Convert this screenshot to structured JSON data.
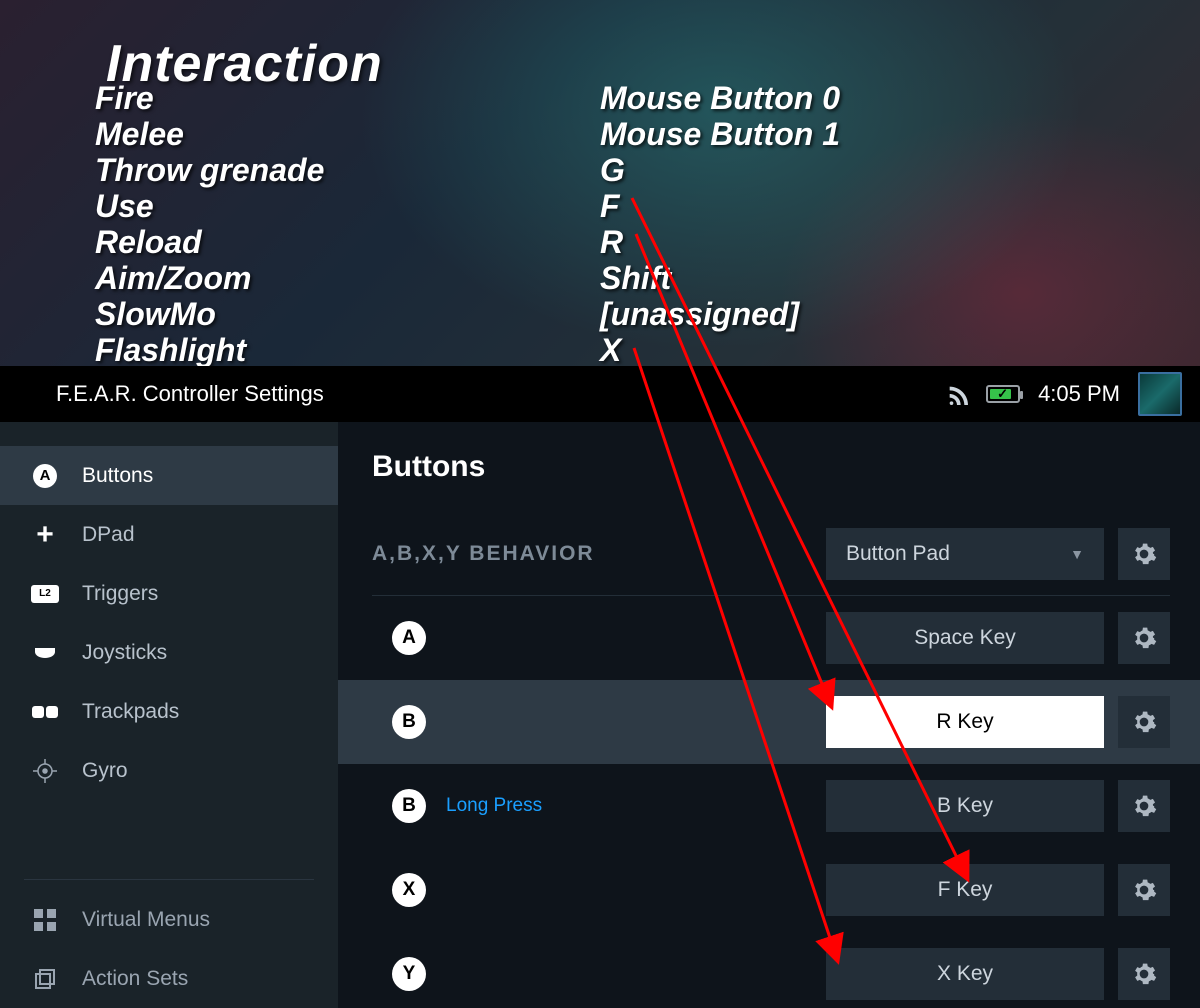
{
  "game": {
    "section_title": "Interaction",
    "bindings": [
      {
        "label": "Fire",
        "value": "Mouse Button 0"
      },
      {
        "label": "Melee",
        "value": "Mouse Button 1"
      },
      {
        "label": "Throw grenade",
        "value": "G"
      },
      {
        "label": "Use",
        "value": "F"
      },
      {
        "label": "Reload",
        "value": "R"
      },
      {
        "label": "Aim/Zoom",
        "value": "Shift"
      },
      {
        "label": "SlowMo",
        "value": "[unassigned]"
      },
      {
        "label": "Flashlight",
        "value": "X"
      }
    ]
  },
  "header": {
    "title": "F.E.A.R. Controller Settings",
    "clock": "4:05 PM"
  },
  "sidebar": {
    "items": [
      {
        "icon": "A",
        "label": "Buttons",
        "active": true
      },
      {
        "icon": "+",
        "label": "DPad"
      },
      {
        "icon": "L2",
        "label": "Triggers"
      },
      {
        "icon": "⌒",
        "label": "Joysticks"
      },
      {
        "icon": "◧",
        "label": "Trackpads"
      },
      {
        "icon": "⊕",
        "label": "Gyro"
      }
    ],
    "lower": [
      {
        "icon": "▦",
        "label": "Virtual Menus"
      },
      {
        "icon": "⎘",
        "label": "Action Sets"
      }
    ]
  },
  "main": {
    "heading": "Buttons",
    "behavior_label": "A,B,X,Y BEHAVIOR",
    "behavior_value": "Button Pad",
    "rows": [
      {
        "letter": "A",
        "sub": "",
        "key": "Space Key",
        "highlight": false,
        "selected": false
      },
      {
        "letter": "B",
        "sub": "",
        "key": "R Key",
        "highlight": true,
        "selected": true
      },
      {
        "letter": "B",
        "sub": "Long Press",
        "key": "B Key",
        "highlight": false,
        "selected": false
      },
      {
        "letter": "X",
        "sub": "",
        "key": "F Key",
        "highlight": false,
        "selected": false
      },
      {
        "letter": "Y",
        "sub": "",
        "key": "X Key",
        "highlight": false,
        "selected": false
      }
    ]
  }
}
